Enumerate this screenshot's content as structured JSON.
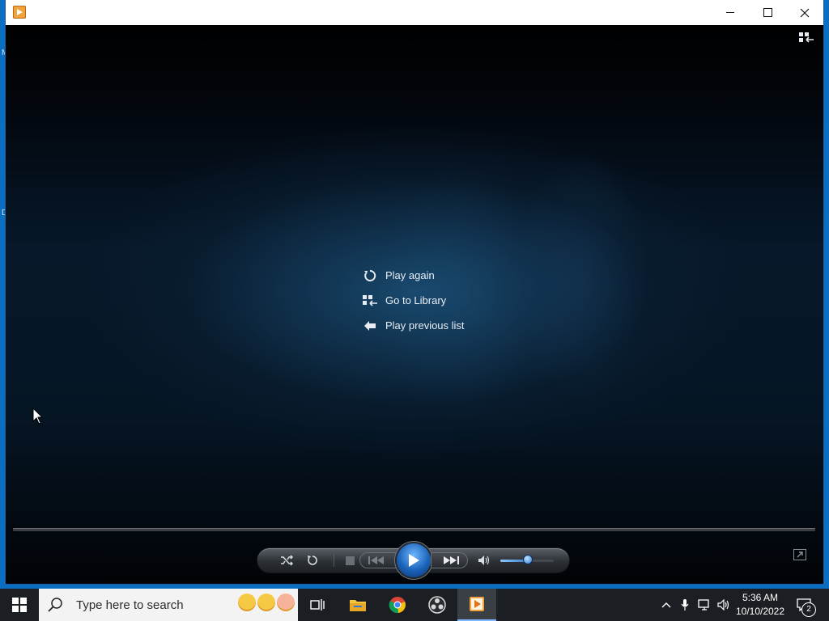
{
  "desktop": {
    "glyph_top": "M",
    "glyph_mid": "D"
  },
  "window": {
    "title": "",
    "controls": {
      "minimize": "minimize",
      "maximize": "maximize",
      "close": "close"
    }
  },
  "end_screen": {
    "items": [
      {
        "label": "Play again",
        "icon": "replay-icon"
      },
      {
        "label": "Go to Library",
        "icon": "library-icon"
      },
      {
        "label": "Play previous list",
        "icon": "back-arrow-icon"
      }
    ]
  },
  "player_controls": {
    "buttons": [
      "shuffle",
      "repeat",
      "stop",
      "previous",
      "play",
      "next",
      "mute"
    ],
    "volume_level": 0.55,
    "accent": "#2e7ad2"
  },
  "taskbar": {
    "search_placeholder": "Type here to search",
    "apps": [
      "task-view",
      "file-explorer",
      "chrome",
      "obs-studio",
      "windows-media-player"
    ],
    "time": "5:36 AM",
    "date": "10/10/2022",
    "notification_count": "2"
  }
}
